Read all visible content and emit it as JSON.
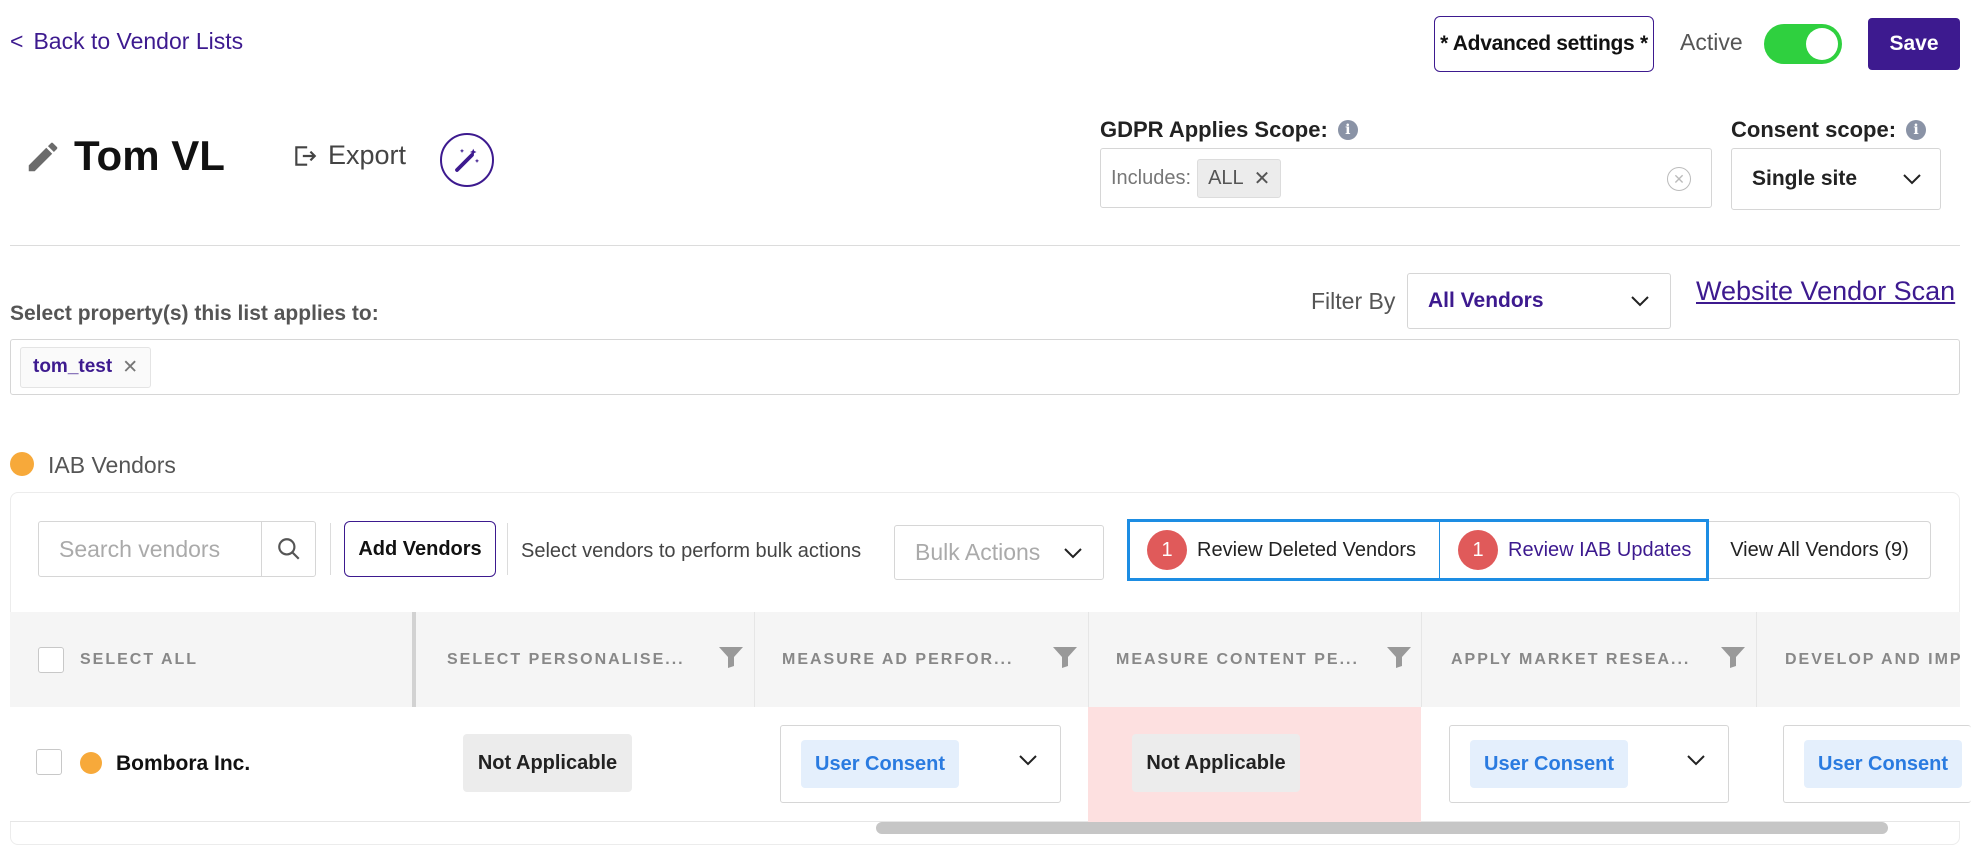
{
  "header": {
    "back_label": "Back to Vendor Lists",
    "back_chevron": "<",
    "advanced_settings_label": "* Advanced settings *",
    "active_label": "Active",
    "active_state": true,
    "save_label": "Save"
  },
  "vendor_list": {
    "title": "Tom VL",
    "export_label": "Export"
  },
  "gdpr_scope": {
    "label": "GDPR Applies Scope:",
    "includes_label": "Includes:",
    "chips": [
      {
        "label": "ALL"
      }
    ]
  },
  "consent_scope": {
    "label": "Consent scope:",
    "value": "Single site"
  },
  "properties": {
    "label": "Select property(s) this list applies to:",
    "chips": [
      {
        "label": "tom_test"
      }
    ]
  },
  "filter": {
    "label": "Filter By",
    "value": "All Vendors",
    "scan_link": "Website Vendor Scan"
  },
  "iab_section": {
    "label": "IAB Vendors",
    "dot_color": "#f7a93a",
    "search_placeholder": "Search vendors",
    "add_vendors_label": "Add Vendors",
    "bulk_hint": "Select vendors to perform bulk actions",
    "bulk_placeholder": "Bulk Actions",
    "review_deleted": {
      "count": "1",
      "label": "Review Deleted Vendors"
    },
    "review_iab": {
      "count": "1",
      "label": "Review IAB Updates"
    },
    "view_all_label": "View All Vendors (9)"
  },
  "table": {
    "select_all_label": "SELECT ALL",
    "columns": [
      "SELECT PERSONALISE...",
      "MEASURE AD PERFOR...",
      "MEASURE CONTENT PE...",
      "APPLY MARKET RESEA...",
      "DEVELOP AND IMP"
    ],
    "rows": [
      {
        "vendor": "Bombora Inc.",
        "cells": [
          "Not Applicable",
          "User Consent",
          "Not Applicable",
          "User Consent",
          "User Consent"
        ]
      }
    ]
  },
  "colors": {
    "brand": "#3d1a8f",
    "toggle_on": "#2fd03f",
    "badge": "#e05a5a",
    "highlight_border": "#1d8de3",
    "not_applicable_cell": "#fde0e0",
    "consent_pill": "#e4effc"
  }
}
